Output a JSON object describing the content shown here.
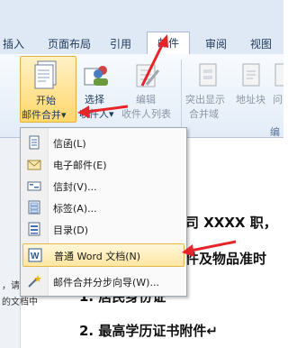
{
  "tabs": [
    "插入",
    "页面布局",
    "引用",
    "邮件",
    "审阅",
    "视图"
  ],
  "ribbon": {
    "start_merge": {
      "line1": "开始",
      "line2": "邮件合并▾"
    },
    "select_recipients": {
      "line1": "选择",
      "line2": "收件人▾"
    },
    "edit_recipients": {
      "line1": "编辑",
      "line2": "收件人列表"
    },
    "highlight": {
      "line1": "突出显示",
      "line2": "合并域"
    },
    "address_block": {
      "line1": "地址块"
    },
    "question": {
      "line1": "问"
    },
    "group_label": "编"
  },
  "menu": {
    "items": [
      {
        "label": "信函(L)",
        "icon": "letter-icon"
      },
      {
        "label": "电子邮件(E)",
        "icon": "email-icon"
      },
      {
        "label": "信封(V)...",
        "icon": "envelope-icon"
      },
      {
        "label": "标签(A)...",
        "icon": "label-icon"
      },
      {
        "label": "目录(D)",
        "icon": "directory-icon"
      },
      {
        "label": "普通 Word 文档(N)",
        "icon": "word-doc-icon"
      },
      {
        "label": "邮件合并分步向导(W)...",
        "icon": "wizard-icon"
      }
    ]
  },
  "document": {
    "line1": "司 XXXX 职，",
    "line2": "件及物品准时",
    "line3": "1.  居民身份证",
    "line4": "2.  最高学历证书附件↵",
    "side1": "，请",
    "side2": "的文档中"
  },
  "colors": {
    "accent_arrow": "#e8242b",
    "highlight": "#ffe7a1"
  }
}
